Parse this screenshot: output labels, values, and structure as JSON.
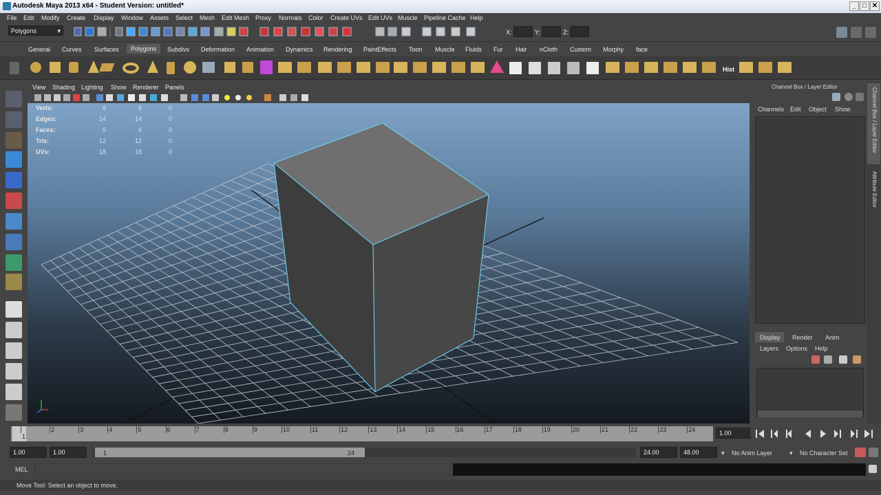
{
  "window": {
    "title": "Autodesk Maya 2013 x64 - Student Version: untitled*",
    "minimize": "_",
    "maximize": "□",
    "close": "✕"
  },
  "menu": [
    "File",
    "Edit",
    "Modify",
    "Create",
    "Display",
    "Window",
    "Assets",
    "Select",
    "Mesh",
    "Edit Mesh",
    "Proxy",
    "Normals",
    "Color",
    "Create UVs",
    "Edit UVs",
    "Muscle",
    "Pipeline Cache",
    "Help"
  ],
  "statusline": {
    "menuset": "Polygons",
    "x_label": "X:",
    "y_label": "Y:",
    "z_label": "Z:"
  },
  "shelf_tabs": [
    "General",
    "Curves",
    "Surfaces",
    "Polygons",
    "Subdivs",
    "Deformation",
    "Animation",
    "Dynamics",
    "Rendering",
    "PaintEffects",
    "Toon",
    "Muscle",
    "Fluids",
    "Fur",
    "Hair",
    "nCloth",
    "Custom",
    "Morphy",
    "face"
  ],
  "shelf_active": "Polygons",
  "shelf_hist_label": "Hist",
  "panel_menu": [
    "View",
    "Shading",
    "Lighting",
    "Show",
    "Renderer",
    "Panels"
  ],
  "hud": [
    {
      "label": "Verts:",
      "a": "8",
      "b": "8",
      "c": "0"
    },
    {
      "label": "Edges:",
      "a": "14",
      "b": "14",
      "c": "0"
    },
    {
      "label": "Faces:",
      "a": "6",
      "b": "6",
      "c": "0"
    },
    {
      "label": "Tris:",
      "a": "12",
      "b": "12",
      "c": "0"
    },
    {
      "label": "UVs:",
      "a": "18",
      "b": "18",
      "c": "0"
    }
  ],
  "channelbox": {
    "title": "Channel Box / Layer Editor",
    "menu": [
      "Channels",
      "Edit",
      "Object",
      "Show"
    ],
    "layer_tabs": [
      "Display",
      "Render",
      "Anim"
    ],
    "layer_menu": [
      "Layers",
      "Options",
      "Help"
    ]
  },
  "sidebar_tabs": [
    "Channel Box / Layer Editor",
    "Attribute Editor"
  ],
  "timeline": {
    "ticks": [
      "1",
      "2",
      "3",
      "4",
      "5",
      "6",
      "7",
      "8",
      "9",
      "10",
      "11",
      "12",
      "13",
      "14",
      "15",
      "16",
      "17",
      "18",
      "19",
      "20",
      "21",
      "22",
      "23",
      "24"
    ],
    "current_time": "1.00"
  },
  "range": {
    "start": "1.00",
    "anim_start": "1.00",
    "range_start": "1",
    "range_end": "24",
    "anim_end": "24.00",
    "end": "48.00",
    "anim_layer": "No Anim Layer",
    "char_set": "No Character Set"
  },
  "cmdline": {
    "label": "MEL"
  },
  "helpline": {
    "text": "Move Tool: Select an object to move."
  },
  "colors": {
    "selection_edge": "#6ecff0",
    "grid": "#c8ccd2",
    "accent_tab": "#5a5a5a"
  }
}
